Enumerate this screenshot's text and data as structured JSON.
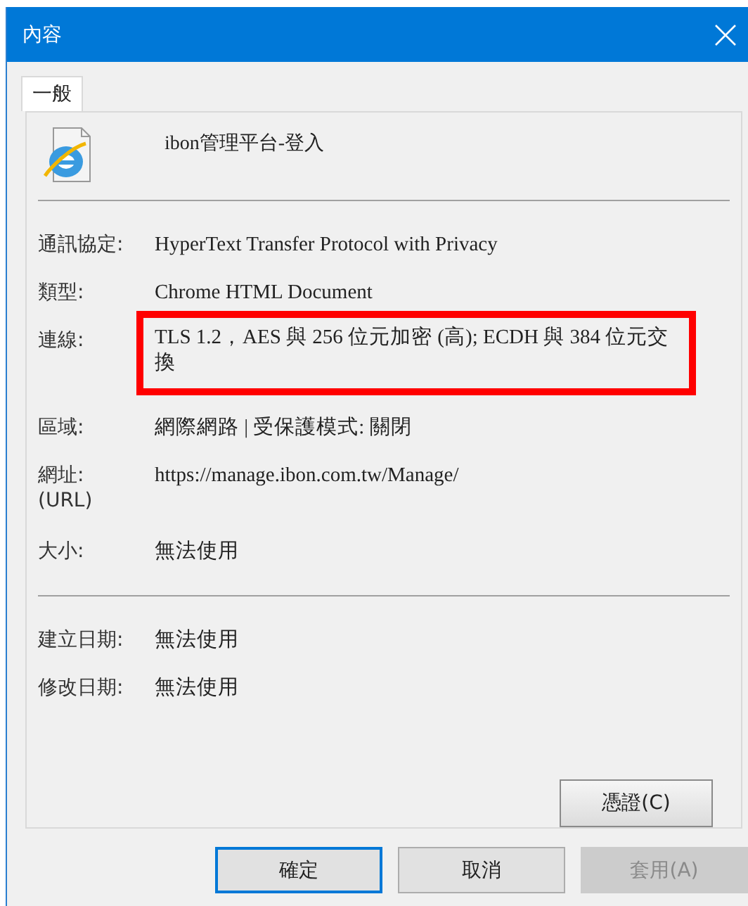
{
  "window": {
    "title": "內容"
  },
  "tabs": [
    {
      "label": "一般",
      "selected": true
    }
  ],
  "header": {
    "title": "ibon管理平台-登入"
  },
  "details": [
    {
      "label": "通訊協定:",
      "value": "HyperText Transfer Protocol with Privacy",
      "highlighted": false
    },
    {
      "label": "類型:",
      "value": "Chrome HTML Document",
      "highlighted": false
    },
    {
      "label": "連線:",
      "value": "TLS 1.2，AES 與 256 位元加密 (高); ECDH 與 384 位元交換",
      "highlighted": true
    },
    {
      "label": "區域:",
      "value": "網際網路 | 受保護模式: 關閉",
      "highlighted": false
    },
    {
      "label": "網址:\n(URL)",
      "value": "https://manage.ibon.com.tw/Manage/",
      "highlighted": false
    },
    {
      "label": "大小:",
      "value": "無法使用",
      "highlighted": false
    }
  ],
  "dates": [
    {
      "label": "建立日期:",
      "value": "無法使用"
    },
    {
      "label": "修改日期:",
      "value": "無法使用"
    }
  ],
  "certificate_button": "憑證(C)",
  "buttons": [
    {
      "label": "確定",
      "default": true,
      "disabled": false
    },
    {
      "label": "取消",
      "default": false,
      "disabled": false
    },
    {
      "label": "套用(A)",
      "default": false,
      "disabled": true
    }
  ]
}
